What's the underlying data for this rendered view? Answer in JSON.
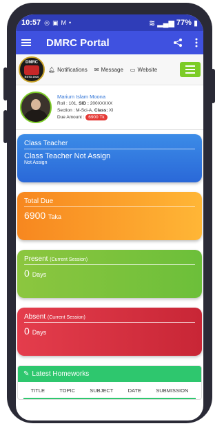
{
  "status": {
    "time": "10:57",
    "battery": "77%"
  },
  "appbar": {
    "title": "DMRC Portal"
  },
  "nav": {
    "logo_text": "DMRC",
    "logo_sub": "ESTD 2010",
    "links": [
      {
        "label": "Notifications",
        "icon": "bell-icon"
      },
      {
        "label": "Message",
        "icon": "envelope-icon"
      },
      {
        "label": "Website",
        "icon": "monitor-icon"
      }
    ]
  },
  "profile": {
    "name": "Marium Islam Moona",
    "roll_label": "Roll :",
    "roll": "101,",
    "sid_label": "SID :",
    "sid": "200XXXXX",
    "section_label": "Section :",
    "section": "M-Sci-A,",
    "class_label": "Class:",
    "class": "XI",
    "due_label": "Due Amount :",
    "due": "6900 Tk"
  },
  "cards": {
    "teacher": {
      "label": "Class Teacher",
      "value": "Class Teacher Not Assign",
      "sub": "Not Assign"
    },
    "due": {
      "label": "Total Due",
      "value": "6900",
      "unit": "Taka"
    },
    "present": {
      "label": "Present",
      "note": "(Current Session)",
      "value": "0",
      "unit": "Days"
    },
    "absent": {
      "label": "Absent",
      "note": "(Current Session)",
      "value": "0",
      "unit": "Days"
    }
  },
  "homework": {
    "title": "Latest Homeworks",
    "columns": [
      "TITLE",
      "TOPIC",
      "SUBJECT",
      "DATE",
      "SUBMISSION"
    ]
  },
  "colors": {
    "statusbar": "#2f3db8",
    "appbar": "#3f51e0",
    "accent_green": "#7ccc27"
  }
}
